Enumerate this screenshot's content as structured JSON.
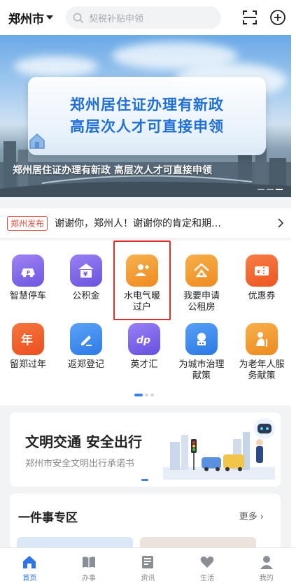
{
  "header": {
    "city": "郑州市",
    "search_placeholder": "契税补贴申领"
  },
  "banner": {
    "card_line1": "郑州居住证办理有新政",
    "card_line2": "高层次人才可直接申领",
    "caption": "郑州居住证办理有新政 高层次人才可直接申领"
  },
  "news": {
    "tag": "郑州发布",
    "text": "谢谢你，郑州人！谢谢你的肯定和期…"
  },
  "services": [
    {
      "label": "智慧停车",
      "icon": "parking-icon",
      "color": "#8a6cf0"
    },
    {
      "label": "公积金",
      "icon": "fund-icon",
      "color": "#7b63e8"
    },
    {
      "label": "水电气暖过户",
      "icon": "utility-transfer-icon",
      "color": "#f19a34"
    },
    {
      "label": "我要申请公租房",
      "icon": "rental-housing-icon",
      "color": "#f29a2e"
    },
    {
      "label": "优惠券",
      "icon": "coupon-icon",
      "color": "#f26b2e"
    },
    {
      "label": "留郑过年",
      "icon": "new-year-icon",
      "color": "#f0642c"
    },
    {
      "label": "返郑登记",
      "icon": "register-icon",
      "color": "#3d8cf0"
    },
    {
      "label": "英才汇",
      "icon": "talent-icon",
      "color": "#7f63ea"
    },
    {
      "label": "为城市治理献策",
      "icon": "city-governance-icon",
      "color": "#3b8bf0"
    },
    {
      "label": "为老年人服务献策",
      "icon": "elderly-service-icon",
      "color": "#f2992e"
    }
  ],
  "civilization": {
    "title": "文明交通  安全出行",
    "subtitle": "郑州市安全文明出行承诺书"
  },
  "zone": {
    "title": "一件事专区",
    "more": "更多"
  },
  "tabbar": [
    {
      "label": "首页",
      "icon": "home-icon",
      "active": true
    },
    {
      "label": "办事",
      "icon": "book-icon",
      "active": false
    },
    {
      "label": "资讯",
      "icon": "news-icon",
      "active": false
    },
    {
      "label": "生活",
      "icon": "heart-icon",
      "active": false
    },
    {
      "label": "我的",
      "icon": "user-icon",
      "active": false
    }
  ],
  "colors": {
    "accent": "#2f75ea",
    "highlight_border": "#e32c2c",
    "news_tag": "#e24a3b"
  }
}
